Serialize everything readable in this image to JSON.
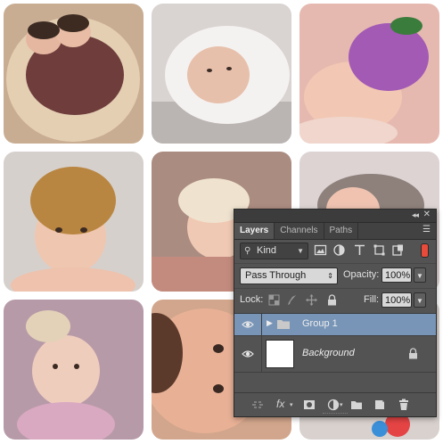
{
  "photos": [
    {
      "name": "twins-on-fur",
      "bg": "#c9ad92"
    },
    {
      "name": "baby-in-white-towel",
      "bg": "#d9d3d1"
    },
    {
      "name": "baby-in-purple-flower-hat",
      "bg": "#e6b9b0"
    },
    {
      "name": "baby-in-knit-brown-hat",
      "bg": "#d6d0cd"
    },
    {
      "name": "baby-in-cream-bonnet",
      "bg": "#ab8c81"
    },
    {
      "name": "baby-in-nest",
      "bg": "#ddd3d3"
    },
    {
      "name": "baby-with-flower-headband",
      "bg": "#b79aa8"
    },
    {
      "name": "baby-face-closeup",
      "bg": "#d2a68c"
    },
    {
      "name": "baby-with-toy",
      "bg": "#d8d1ce"
    }
  ],
  "layers_panel": {
    "tabs": [
      "Layers",
      "Channels",
      "Paths"
    ],
    "active_tab": "Layers",
    "filter": {
      "label": "Kind",
      "icons": [
        "image-filter-icon",
        "adjustment-filter-icon",
        "type-filter-icon",
        "shape-filter-icon",
        "smart-object-filter-icon"
      ]
    },
    "blend_mode": "Pass Through",
    "opacity_label": "Opacity:",
    "opacity_value": "100%",
    "lock_label": "Lock:",
    "fill_label": "Fill:",
    "fill_value": "100%",
    "layers": [
      {
        "name": "Group 1",
        "type": "group",
        "selected": true,
        "visible": true
      },
      {
        "name": "Background",
        "type": "background",
        "selected": false,
        "visible": true,
        "locked": true
      }
    ],
    "accent_color": "#7895b7",
    "panel_color": "#535353"
  }
}
